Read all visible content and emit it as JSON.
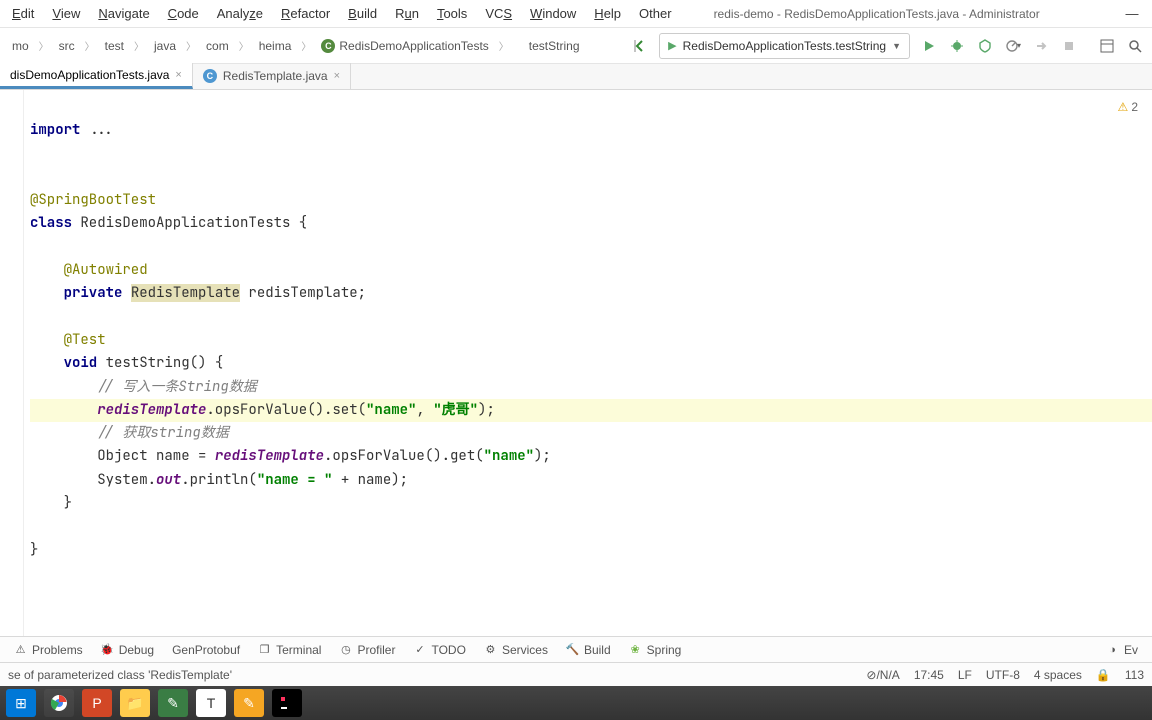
{
  "menu": {
    "items": [
      "Edit",
      "View",
      "Navigate",
      "Code",
      "Analyze",
      "Refactor",
      "Build",
      "Run",
      "Tools",
      "VCS",
      "Window",
      "Help",
      "Other"
    ]
  },
  "title": "redis-demo - RedisDemoApplicationTests.java - Administrator",
  "breadcrumb": [
    "mo",
    "src",
    "test",
    "java",
    "com",
    "heima"
  ],
  "breadcrumb_class": "RedisDemoApplicationTests",
  "breadcrumb_method": "testString",
  "run_config": {
    "label": "RedisDemoApplicationTests.testString"
  },
  "tabs": [
    {
      "label": "disDemoApplicationTests.java",
      "active": true
    },
    {
      "label": "RedisTemplate.java",
      "active": false
    }
  ],
  "inspection": {
    "warnings": "2"
  },
  "code": {
    "l1a": "import",
    "l1b": " ...",
    "l2": "",
    "l3": "@SpringBootTest",
    "l4a": "class",
    "l4b": " RedisDemoApplicationTests {",
    "l5": "",
    "l6": "    @Autowired",
    "l7a": "    ",
    "l7b": "private",
    "l7c": " ",
    "l7d": "RedisTemplate",
    "l7e": " redisTemplate;",
    "l8": "",
    "l9": "    @Test",
    "l10a": "    ",
    "l10b": "void",
    "l10c": " testString() {",
    "l11a": "        ",
    "l11b": "// 写入一条String数据",
    "l12a": "        ",
    "l12b": "redisTemplate",
    "l12c": ".opsForValue().set(",
    "l12d": "\"name\"",
    "l12e": ", ",
    "l12f": "\"虎哥\"",
    "l12g": ");",
    "l13a": "        ",
    "l13b": "// 获取string数据",
    "l14a": "        Object name = ",
    "l14b": "redisTemplate",
    "l14c": ".opsForValue().get(",
    "l14d": "\"name\"",
    "l14e": ");",
    "l15a": "        System.",
    "l15b": "out",
    "l15c": ".println(",
    "l15d": "\"name = \"",
    "l15e": " + name);",
    "l16": "    }",
    "l17": "",
    "l18": "}"
  },
  "tool_windows": [
    "Problems",
    "Debug",
    "GenProtobuf",
    "Terminal",
    "Profiler",
    "TODO",
    "Services",
    "Build",
    "Spring"
  ],
  "tool_right": "Ev",
  "status": {
    "message": "se of parameterized class 'RedisTemplate'",
    "na": "⊘/N/A",
    "time": "17:45",
    "lf": "LF",
    "encoding": "UTF-8",
    "indent": "4 spaces",
    "linecol": "113"
  }
}
